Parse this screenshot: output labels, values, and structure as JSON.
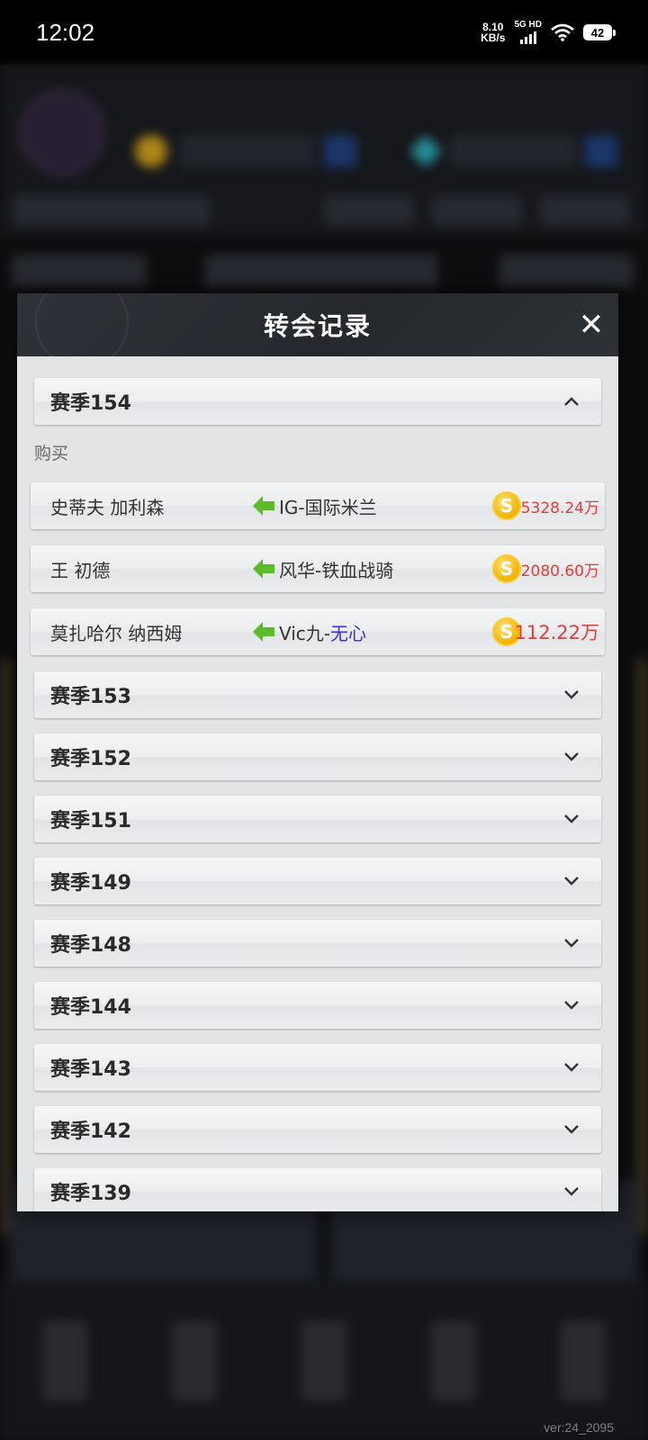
{
  "status_bar": {
    "time": "12:02",
    "net_speed_value": "8.10",
    "net_speed_unit": "KB/s",
    "network_type": "5G HD",
    "battery": "42"
  },
  "modal": {
    "title": "转会记录",
    "close_icon": "close-icon",
    "expanded_season": {
      "label": "赛季154",
      "section_label": "购买",
      "transfers": [
        {
          "player": "史蒂夫 加利森",
          "team_prefix": "IG-",
          "team_name": "国际米兰",
          "team_name_color": "#333333",
          "price": "5328.24万"
        },
        {
          "player": "王 初德",
          "team_prefix": "风华-",
          "team_name": "铁血战骑",
          "team_name_color": "#333333",
          "price": "2080.60万"
        },
        {
          "player": "莫扎哈尔 纳西姆",
          "team_prefix": "Vic九-",
          "team_name": "无心",
          "team_name_color": "#3b2fd8",
          "price": "112.22万"
        }
      ]
    },
    "collapsed_seasons": [
      "赛季153",
      "赛季152",
      "赛季151",
      "赛季149",
      "赛季148",
      "赛季144",
      "赛季143",
      "赛季142",
      "赛季139"
    ]
  },
  "footer": {
    "version": "ver:24_2095"
  },
  "colors": {
    "price": "#e0403c",
    "arrow": "#5dbb2a",
    "coin": "#f2b300"
  }
}
